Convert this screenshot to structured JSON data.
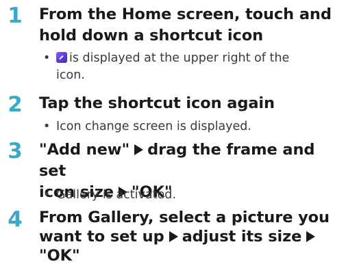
{
  "steps": [
    {
      "number": "1",
      "title_line1": "From the Home screen, touch and",
      "title_line2": "hold down a shortcut icon",
      "note_icon": "purple-edit-badge-icon",
      "note_line1": "is displayed at the upper right of the",
      "note_line2": "icon."
    },
    {
      "number": "2",
      "title": "Tap the shortcut icon again",
      "note": "Icon change screen is displayed."
    },
    {
      "number": "3",
      "title_line1_a": "\"Add new\"",
      "title_line1_b": "drag the frame and set",
      "title_line2_a": "icon size",
      "title_line2_b": "\"OK\"",
      "note": "Gallery is activated."
    },
    {
      "number": "4",
      "title_line1": "From Gallery, select a picture you",
      "title_line2_a": "want to set up",
      "title_line2_b": "adjust its size",
      "title_line3": "\"OK\""
    }
  ],
  "bullet_char": "•",
  "colors": {
    "step_number": "#3aa9c8",
    "text": "#1a1a1a",
    "note_text": "#3a3a3a",
    "badge": "#6b47e0"
  }
}
